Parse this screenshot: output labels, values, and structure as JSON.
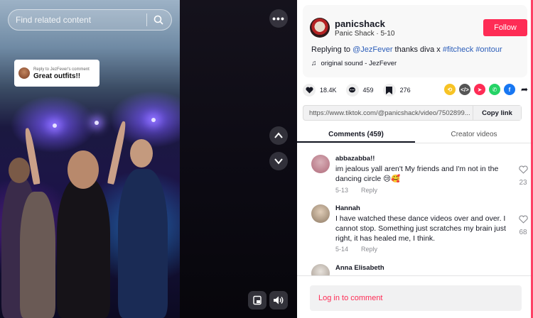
{
  "search": {
    "placeholder": "Find related content"
  },
  "reply_bubble": {
    "small": "Reply to JezFever's comment",
    "big": "Great outfits!!"
  },
  "post": {
    "username": "panicshack",
    "subline": "Panic Shack · 5-10",
    "follow_label": "Follow",
    "caption_prefix": "Replying to ",
    "caption_mention": "@JezFever",
    "caption_text": " thanks diva x ",
    "caption_tag1": "#fitcheck",
    "caption_tag2": "#ontour",
    "sound": "original sound - JezFever"
  },
  "actions": {
    "likes": "18.4K",
    "comments": "459",
    "saves": "276"
  },
  "share": {
    "url": "https://www.tiktok.com/@panicshack/video/7502899...",
    "copy_label": "Copy link",
    "icons": [
      "repost-icon",
      "embed-icon",
      "send-icon",
      "whatsapp-icon",
      "facebook-icon",
      "share-arrow-icon"
    ]
  },
  "tabs": [
    {
      "label": "Comments (459)",
      "active": true
    },
    {
      "label": "Creator videos",
      "active": false
    }
  ],
  "comments": [
    {
      "name": "abbazabba!!",
      "text": "im jealous yall aren't My friends and I'm not in the dancing circle 😢🥰",
      "date": "5-13",
      "reply": "Reply",
      "likes": "23"
    },
    {
      "name": "Hannah",
      "text": "I have watched these dance videos over and over. I cannot stop. Something just scratches my brain just right, it has healed me, I think.",
      "date": "5-14",
      "reply": "Reply",
      "likes": "68"
    },
    {
      "name": "Anna Elisabeth",
      "text": "",
      "date": "",
      "reply": "",
      "likes": ""
    }
  ],
  "login_label": "Log in to comment",
  "colors": {
    "brand_red": "#fe2c55",
    "link_blue": "#2b5db9"
  }
}
